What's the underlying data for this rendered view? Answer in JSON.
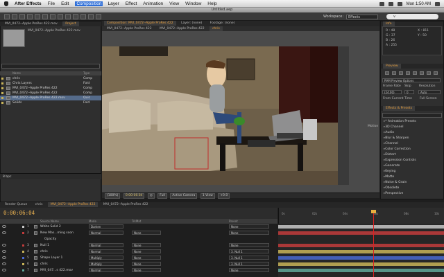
{
  "menubar": {
    "app": "After Effects",
    "items": [
      "File",
      "Edit",
      "Composition",
      "Layer",
      "Effect",
      "Animation",
      "View",
      "Window",
      "Help"
    ],
    "selected": "Composition",
    "clock": "Mon 1:50 AM"
  },
  "window": {
    "title": "Untitled.aep"
  },
  "toolbar": {
    "workspace_label": "Workspace:",
    "workspace_value": "Effects",
    "search_placeholder": "v"
  },
  "project": {
    "tab_name": "Project",
    "selected_item": "MVI_0472--Apple ProRes 422.mov",
    "columns": {
      "name": "Name",
      "type": "Type"
    },
    "items": [
      {
        "name": "chris",
        "type": "Comp"
      },
      {
        "name": "Chris Layers",
        "type": "Fold"
      },
      {
        "name": "MVI_0472--Apple ProRes 422",
        "type": "Comp"
      },
      {
        "name": "MVI_0472--Apple ProRes 422",
        "type": "Comp"
      },
      {
        "name": "MVI_0472--Apple ProRes 422.mov",
        "type": "Quic"
      },
      {
        "name": "Solids",
        "type": "Fold"
      }
    ],
    "footer_bpc": "8 bpc"
  },
  "composition": {
    "tabs": [
      "Composition: MVI_0472--Apple ProRes 422",
      "Layer: (none)",
      "Footage: (none)"
    ],
    "subtabs": [
      "MVI_0472--Apple ProRes 422",
      "MVI_0472--Apple ProRes 422",
      "chris"
    ],
    "zoom": "(100%)",
    "timecode": "0:00:06:04",
    "resolution": "Full",
    "camera": "Active Camera",
    "view": "1 View",
    "exposure": "+0.0"
  },
  "info": {
    "tab": "Info",
    "r": "R : 48",
    "g": "G : 37",
    "b": "B : 26",
    "a": "A : 255",
    "x": "X : 811",
    "y": "Y : 50"
  },
  "preview": {
    "tab": "Preview",
    "ram_options": "RAM Preview Options",
    "frame_rate_label": "Frame Rate",
    "skip_label": "Skip",
    "resolution_label": "Resolution",
    "frame_rate_value": "(24.00)",
    "skip_value": "0",
    "resolution_value": "Auto",
    "from_current": "From Current Time",
    "full_screen": "Full Screen"
  },
  "effects": {
    "tab": "Effects & Presets",
    "items": [
      "* Animation Presets",
      "3D Channel",
      "Audio",
      "Blur & Sharpen",
      "Channel",
      "Color Correction",
      "Distort",
      "Expression Controls",
      "Generate",
      "Keying",
      "Matte",
      "Noise & Grain",
      "Obsolete",
      "Perspective"
    ]
  },
  "motion_label": "Motion",
  "timeline": {
    "tabs": [
      "Render Queue",
      "chris",
      "MVI_0472--Apple ProRes 422",
      "MVI_0472--Apple ProRes 422"
    ],
    "time": "0:00:06:04",
    "columns": {
      "name": "Source Name",
      "mode": "Mode",
      "trkmat": "TrkMat",
      "parent": "Parent"
    },
    "ruler": [
      "0s",
      "02s",
      "04s",
      "06s",
      "08s",
      "10s"
    ],
    "layers": [
      {
        "num": "1",
        "name": "White Solid 2",
        "mode": "Darken",
        "trkmat": "",
        "parent": "None",
        "color": "#c9c9c9"
      },
      {
        "num": "2",
        "name": "New Mas...ming soon",
        "mode": "Normal",
        "trkmat": "None",
        "parent": "None",
        "color": "#c23c3c"
      },
      {
        "num": "",
        "name": "Opacity",
        "mode": "",
        "trkmat": "",
        "parent": "",
        "color": ""
      },
      {
        "num": "3",
        "name": "Null 1",
        "mode": "Normal",
        "trkmat": "None",
        "parent": "None",
        "color": "#c23c3c"
      },
      {
        "num": "4",
        "name": "chris",
        "mode": "Normal",
        "trkmat": "None",
        "parent": "3. Null 1",
        "color": "#c9b458"
      },
      {
        "num": "5",
        "name": "Shape Layer 1",
        "mode": "Multiply",
        "trkmat": "None",
        "parent": "3. Null 1",
        "color": "#4a6ad0"
      },
      {
        "num": "6",
        "name": "chris",
        "mode": "Multiply",
        "trkmat": "None",
        "parent": "3. Null 1",
        "color": "#c9b458"
      },
      {
        "num": "7",
        "name": "MVI_047...s 422.mov",
        "mode": "Normal",
        "trkmat": "None",
        "parent": "None",
        "color": "#5fa89a"
      }
    ]
  }
}
